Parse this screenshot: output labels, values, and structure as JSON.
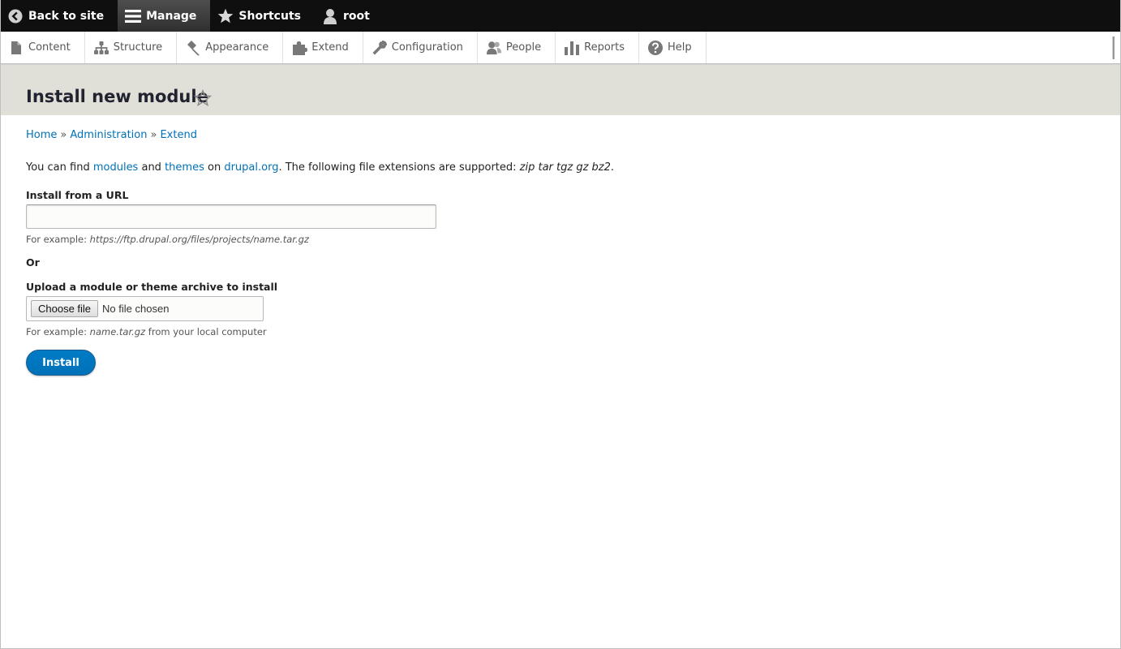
{
  "toolbar": {
    "back_to_site": "Back to site",
    "manage": "Manage",
    "shortcuts": "Shortcuts",
    "user": "root"
  },
  "tray": {
    "items": [
      {
        "label": "Content",
        "icon": "file-icon"
      },
      {
        "label": "Structure",
        "icon": "sitemap-icon"
      },
      {
        "label": "Appearance",
        "icon": "paintbrush-icon"
      },
      {
        "label": "Extend",
        "icon": "puzzle-icon"
      },
      {
        "label": "Configuration",
        "icon": "wrench-icon"
      },
      {
        "label": "People",
        "icon": "people-icon"
      },
      {
        "label": "Reports",
        "icon": "bar-chart-icon"
      },
      {
        "label": "Help",
        "icon": "help-icon"
      }
    ]
  },
  "page": {
    "title": "Install new module"
  },
  "breadcrumb": {
    "home": "Home",
    "sep": "»",
    "administration": "Administration",
    "extend": "Extend"
  },
  "intro": {
    "part1": "You can find ",
    "modules": "modules",
    "and": " and ",
    "themes": "themes",
    "on": " on ",
    "drupal": "drupal.org",
    "part2": ". The following file extensions are supported: ",
    "extensions": "zip tar tgz gz bz2",
    "end": "."
  },
  "url_field": {
    "label": "Install from a URL",
    "value": "",
    "desc_prefix": "For example: ",
    "desc_example": "https://ftp.drupal.org/files/projects/name.tar.gz"
  },
  "or_label": "Or",
  "upload_field": {
    "label": "Upload a module or theme archive to install",
    "button": "Choose file",
    "status": "No file chosen",
    "desc_prefix": "For example: ",
    "desc_example": "name.tar.gz",
    "desc_suffix": " from your local computer"
  },
  "install_button": "Install",
  "colors": {
    "link": "#0071b8",
    "toolbar_bg": "#0f0f0f",
    "header_bg": "#e0e0d8",
    "button": "#0071b8"
  }
}
